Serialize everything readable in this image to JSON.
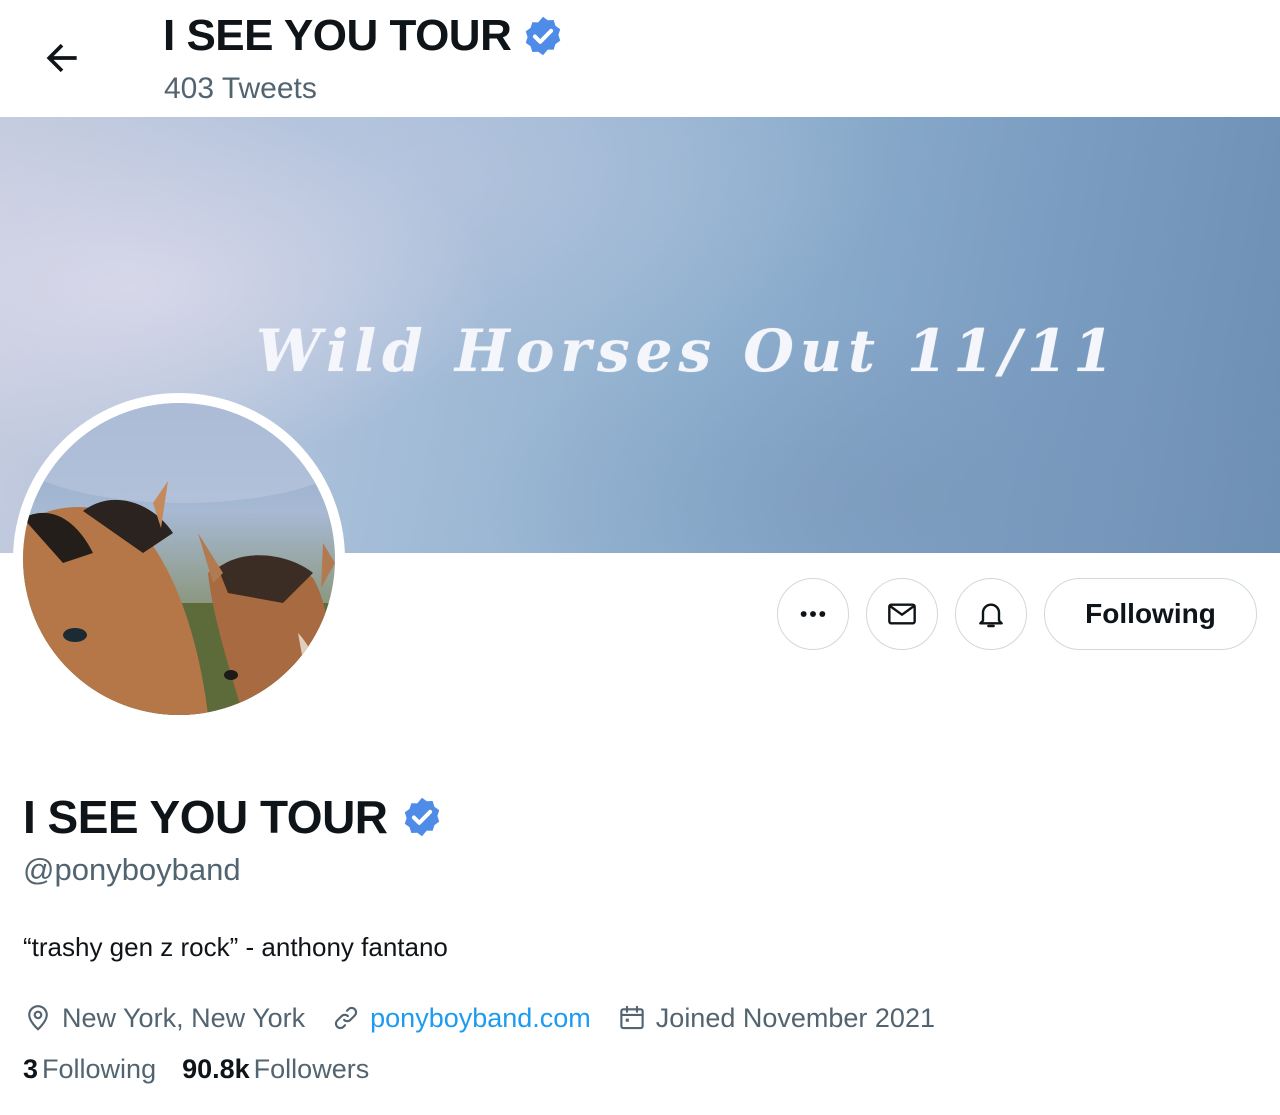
{
  "header": {
    "title": "I SEE YOU TOUR",
    "tweet_count": "403 Tweets"
  },
  "banner": {
    "text": "Wild Horses Out 11/11"
  },
  "actions": {
    "following_label": "Following"
  },
  "profile": {
    "name": "I SEE YOU TOUR",
    "handle": "@ponyboyband",
    "bio": "“trashy gen z rock” - anthony fantano",
    "location": "New York, New York",
    "website": "ponyboyband.com",
    "joined": "Joined November 2021"
  },
  "stats": {
    "following_count": "3",
    "following_label": "Following",
    "followers_count": "90.8k",
    "followers_label": "Followers"
  },
  "colors": {
    "verified": "#4f8ce8",
    "link": "#1d9bf0",
    "muted": "#536471",
    "text": "#0f1419"
  },
  "icons": {
    "back": "arrow-left-icon",
    "verified": "verified-badge-icon",
    "more": "more-dots-icon",
    "message": "envelope-icon",
    "notify": "bell-icon",
    "location": "location-pin-icon",
    "link": "link-icon",
    "calendar": "calendar-icon"
  }
}
